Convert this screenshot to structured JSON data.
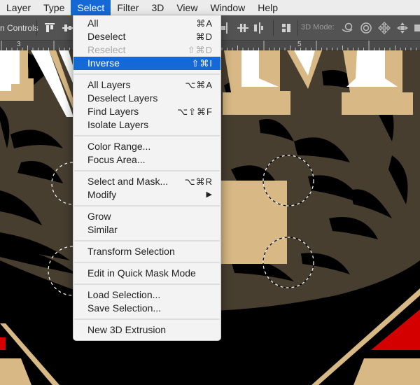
{
  "menubar": {
    "items": [
      {
        "label": "Layer"
      },
      {
        "label": "Type"
      },
      {
        "label": "Select",
        "active": true
      },
      {
        "label": "Filter"
      },
      {
        "label": "3D"
      },
      {
        "label": "View"
      },
      {
        "label": "Window"
      },
      {
        "label": "Help"
      }
    ]
  },
  "optionsbar": {
    "transform_controls_label": "n Controls",
    "mode_3d_label": "3D Mode:",
    "icons": [
      "align-top-edges-icon",
      "align-vertical-centers-icon",
      "distribute-left-icon",
      "distribute-horizontal-centers-icon",
      "distribute-right-icon",
      "auto-align-layers-icon",
      "3d-orbit-icon",
      "3d-roll-icon",
      "3d-pan-icon",
      "3d-slide-icon"
    ]
  },
  "ruler": {
    "labels": [
      "3",
      "5"
    ]
  },
  "select_menu": {
    "groups": [
      [
        {
          "label": "All",
          "shortcut": "⌘A"
        },
        {
          "label": "Deselect",
          "shortcut": "⌘D"
        },
        {
          "label": "Reselect",
          "shortcut": "⇧⌘D",
          "disabled": true
        },
        {
          "label": "Inverse",
          "shortcut": "⇧⌘I",
          "highlighted": true
        }
      ],
      [
        {
          "label": "All Layers",
          "shortcut": "⌥⌘A"
        },
        {
          "label": "Deselect Layers",
          "shortcut": ""
        },
        {
          "label": "Find Layers",
          "shortcut": "⌥⇧⌘F"
        },
        {
          "label": "Isolate Layers",
          "shortcut": ""
        }
      ],
      [
        {
          "label": "Color Range...",
          "shortcut": ""
        },
        {
          "label": "Focus Area...",
          "shortcut": ""
        }
      ],
      [
        {
          "label": "Select and Mask...",
          "shortcut": "⌥⌘R"
        },
        {
          "label": "Modify",
          "shortcut": "",
          "submenu": "▶"
        }
      ],
      [
        {
          "label": "Grow",
          "shortcut": ""
        },
        {
          "label": "Similar",
          "shortcut": ""
        }
      ],
      [
        {
          "label": "Transform Selection",
          "shortcut": ""
        }
      ],
      [
        {
          "label": "Edit in Quick Mask Mode",
          "shortcut": ""
        }
      ],
      [
        {
          "label": "Load Selection...",
          "shortcut": ""
        },
        {
          "label": "Save Selection...",
          "shortcut": ""
        }
      ],
      [
        {
          "label": "New 3D Extrusion",
          "shortcut": ""
        }
      ]
    ]
  },
  "colors": {
    "menu_highlight": "#1569d6",
    "artwork_tan": "#d8b985",
    "artwork_bg": "#473e30",
    "artwork_red": "#d40000"
  }
}
